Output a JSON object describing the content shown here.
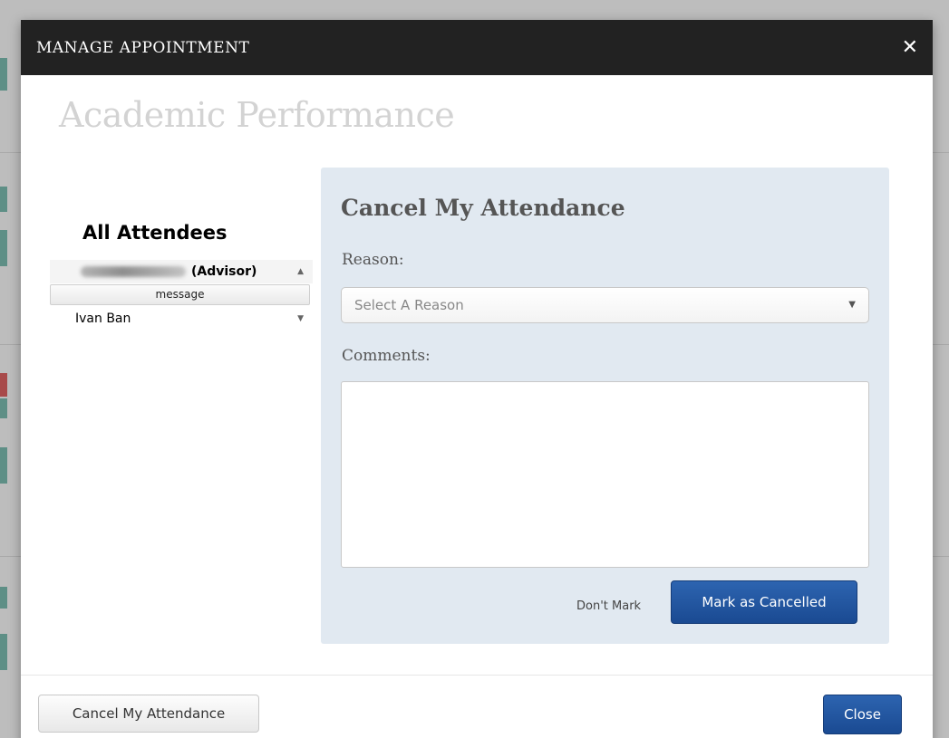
{
  "modal": {
    "title": "MANAGE APPOINTMENT",
    "close_glyph": "✕",
    "heading": "Academic Performance"
  },
  "attendees": {
    "title": "All Attendees",
    "items": [
      {
        "name": "Victoria Myer",
        "role": "(Advisor)",
        "expanded": true,
        "name_blurred": true
      },
      {
        "name": "Ivan Ban",
        "role": "",
        "expanded": false,
        "name_blurred": false
      }
    ],
    "message_label": "message",
    "caret_up": "▲",
    "caret_down": "▼"
  },
  "cancel_form": {
    "title": "Cancel My Attendance",
    "reason_label": "Reason:",
    "reason_placeholder": "Select A Reason",
    "comments_label": "Comments:",
    "comments_value": "",
    "dont_mark_label": "Don't Mark",
    "submit_label": "Mark as Cancelled"
  },
  "footer": {
    "cancel_label": "Cancel My Attendance",
    "close_label": "Close"
  },
  "colors": {
    "header_bg": "#222222",
    "panel_bg": "#e1e9f1",
    "primary_button": "#1f55a0"
  }
}
